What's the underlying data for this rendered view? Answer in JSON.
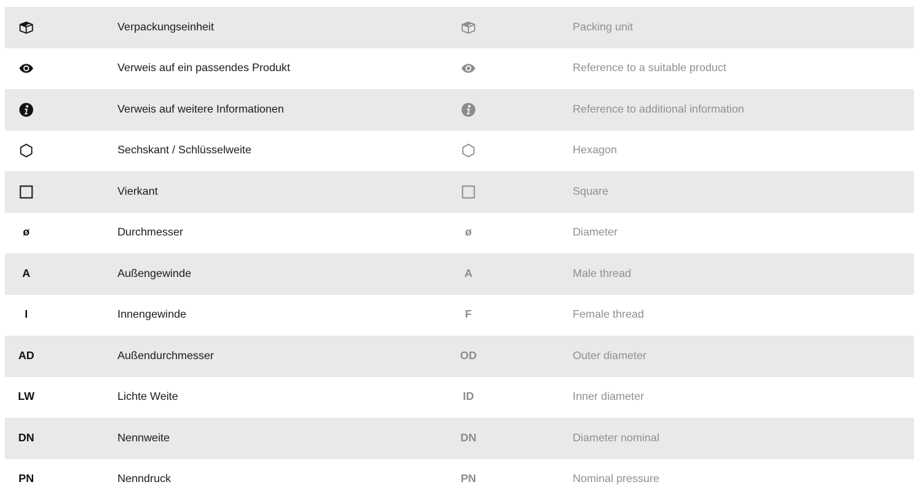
{
  "colors": {
    "shaded_row": "#e9e9e9",
    "text_dark": "#1a1a1a",
    "text_grey": "#8f8f8f",
    "icon_dark": "#111111",
    "icon_grey": "#8c8c8c"
  },
  "rows": [
    {
      "icon": "box-icon",
      "de_symbol": "",
      "de_label": "Verpackungseinheit",
      "en_symbol": "",
      "en_label": "Packing unit"
    },
    {
      "icon": "eye-icon",
      "de_symbol": "",
      "de_label": "Verweis auf ein passendes Produkt",
      "en_symbol": "",
      "en_label": "Reference to a suitable product"
    },
    {
      "icon": "info-icon",
      "de_symbol": "",
      "de_label": "Verweis auf weitere Informationen",
      "en_symbol": "",
      "en_label": "Reference to additional information"
    },
    {
      "icon": "hexagon-icon",
      "de_symbol": "",
      "de_label": "Sechskant / Schlüsselweite",
      "en_symbol": "",
      "en_label": "Hexagon"
    },
    {
      "icon": "square-icon",
      "de_symbol": "",
      "de_label": "Vierkant",
      "en_symbol": "",
      "en_label": "Square"
    },
    {
      "icon": "",
      "de_symbol": "ø",
      "de_label": "Durchmesser",
      "en_symbol": "ø",
      "en_label": "Diameter"
    },
    {
      "icon": "",
      "de_symbol": "A",
      "de_label": "Außengewinde",
      "en_symbol": "A",
      "en_label": "Male thread"
    },
    {
      "icon": "",
      "de_symbol": "I",
      "de_label": "Innengewinde",
      "en_symbol": "F",
      "en_label": "Female thread"
    },
    {
      "icon": "",
      "de_symbol": "AD",
      "de_label": "Außendurchmesser",
      "en_symbol": "OD",
      "en_label": "Outer diameter"
    },
    {
      "icon": "",
      "de_symbol": "LW",
      "de_label": "Lichte Weite",
      "en_symbol": "ID",
      "en_label": "Inner diameter"
    },
    {
      "icon": "",
      "de_symbol": "DN",
      "de_label": "Nennweite",
      "en_symbol": "DN",
      "en_label": "Diameter nominal"
    },
    {
      "icon": "",
      "de_symbol": "PN",
      "de_label": "Nenndruck",
      "en_symbol": "PN",
      "en_label": "Nominal pressure"
    }
  ]
}
